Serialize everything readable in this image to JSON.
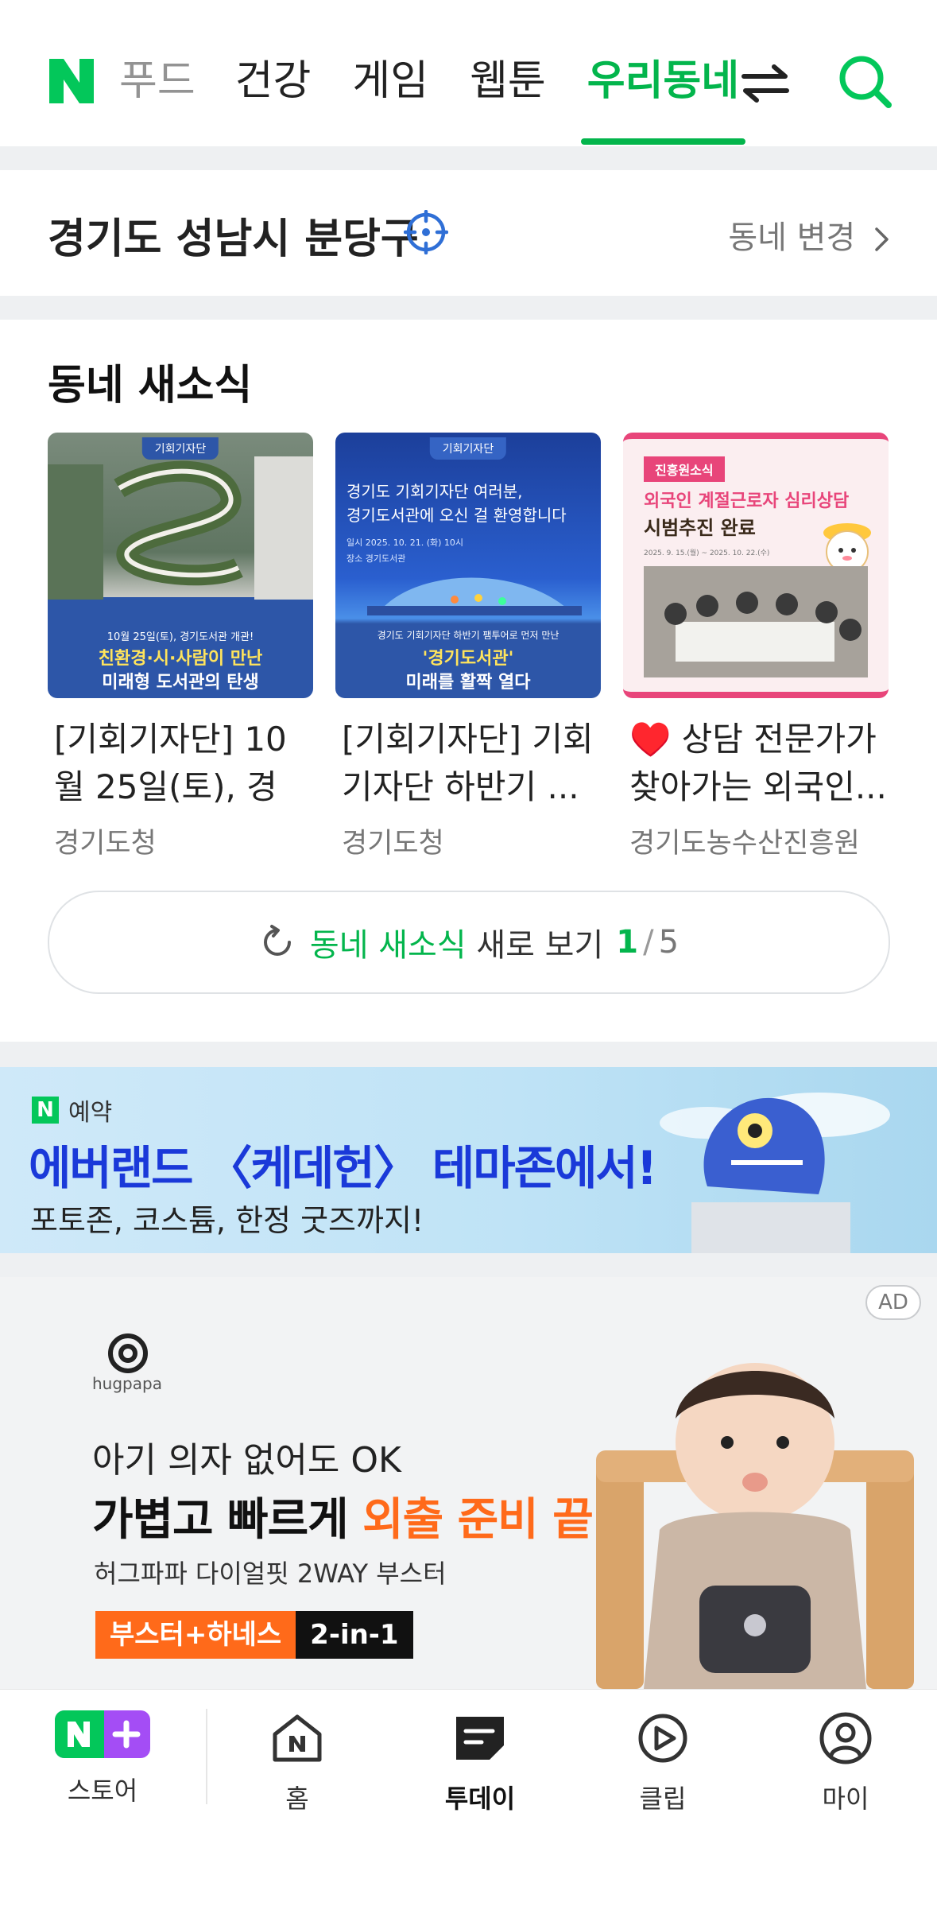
{
  "top_nav": {
    "logo": "N",
    "tabs": [
      {
        "label": "푸드"
      },
      {
        "label": "건강"
      },
      {
        "label": "게임"
      },
      {
        "label": "웹툰"
      },
      {
        "label": "우리동네"
      }
    ],
    "active_tab": "우리동네",
    "icons": [
      "swap-icon",
      "search-icon"
    ]
  },
  "location": {
    "name": "경기도 성남시 분당구",
    "change_label": "동네 변경"
  },
  "news": {
    "title": "동네 새소식",
    "cards": [
      {
        "title": "[기회기자단] 10월 25일(토), 경기...",
        "source": "경기도청",
        "thumb_header": "기회기자단",
        "thumb_caption_1": "10월 25일(토), 경기도서관 개관!",
        "thumb_caption_2": "친환경·시·사람이 만난",
        "thumb_caption_3": "미래형 도서관의 탄생"
      },
      {
        "title": "[기회기자단] 기회기자단 하반기 ...",
        "source": "경기도청",
        "thumb_header": "기회기자단",
        "thumb_text_1": "경기도 기회기자단 여러분,",
        "thumb_text_2": "경기도서관에 오신 걸 환영합니다",
        "thumb_date": "일시  2025. 10. 21. (화) 10시",
        "thumb_place": "장소  경기도서관",
        "thumb_caption_1": "경기도 기회기자단 하반기 팸투어로 먼저 만난",
        "thumb_caption_2": "'경기도서관'",
        "thumb_caption_3": "미래를 활짝 열다"
      },
      {
        "title": "♥️ 상담 전문가가 찾아가는 외국인...",
        "source": "경기도농수산진흥원",
        "thumb_badge": "진흥원소식",
        "thumb_text_1": "외국인 계절근로자 심리상담",
        "thumb_text_2": "시범추진 완료",
        "thumb_date": "2025. 9. 15.(월) ~ 2025. 10. 22.(수)"
      }
    ],
    "refresh": {
      "label_green": "동네 새소식",
      "label_rest": " 새로 보기",
      "page_current": "1",
      "page_separator": "/",
      "page_total": "5"
    }
  },
  "banner_reservation": {
    "tag": "예약",
    "headline": "에버랜드 〈케데헌〉 테마존에서!",
    "subline": "포토존, 코스튬, 한정 굿즈까지!"
  },
  "banner_ad": {
    "ad_label": "AD",
    "brand": "hugpapa",
    "line1": "아기 의자 없어도 OK",
    "line2_black": "가볍고 빠르게 ",
    "line2_orange": "외출 준비 끝!",
    "line3": "허그파파 다이얼핏 2WAY 부스터",
    "tag_orange": "부스터+하네스",
    "tag_black": "2-in-1"
  },
  "bottom_nav": {
    "items": [
      {
        "label": "스토어"
      },
      {
        "label": "홈"
      },
      {
        "label": "투데이"
      },
      {
        "label": "클립"
      },
      {
        "label": "마이"
      }
    ],
    "active": "투데이"
  },
  "colors": {
    "brand_green": "#03c75a",
    "active_green": "#03b54c",
    "reservation_blue": "#1a39d9",
    "ad_orange": "#ff6a1a",
    "location_icon_blue": "#2f6fd6"
  }
}
